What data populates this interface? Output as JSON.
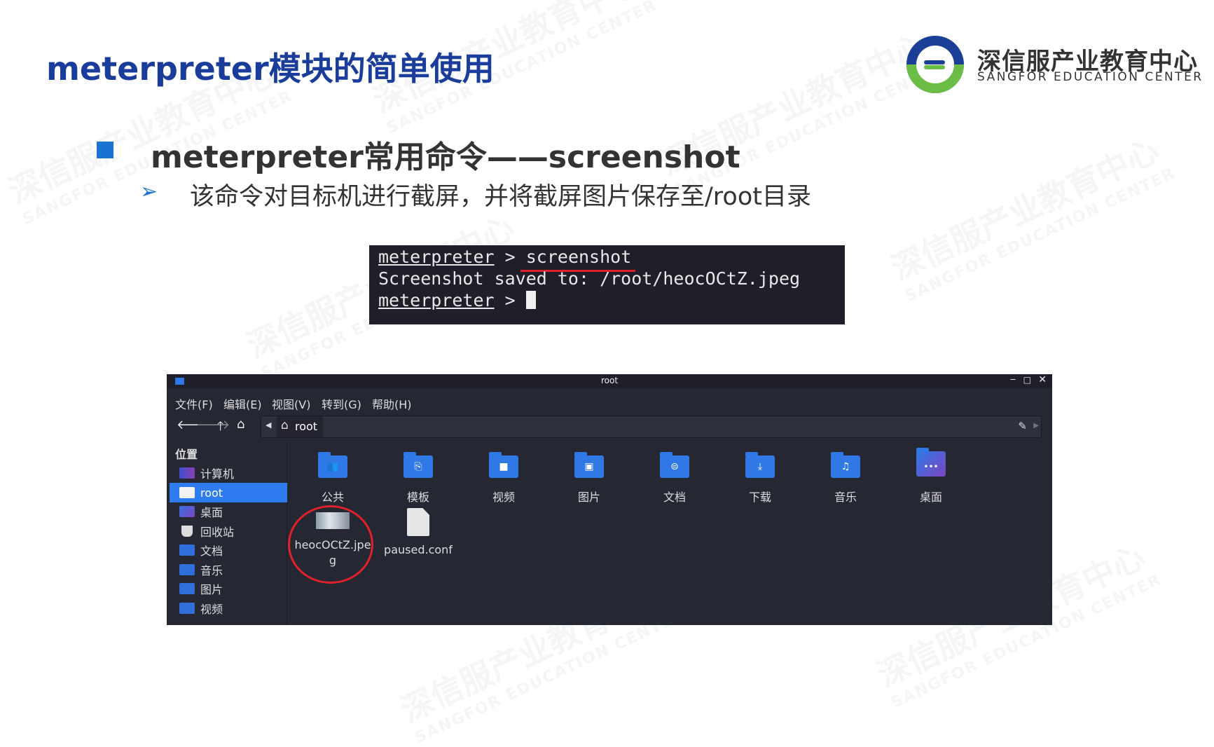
{
  "slide": {
    "title": "meterpreter模块的简单使用",
    "heading": "meterpreter常用命令——screenshot",
    "description": "该命令对目标机进行截屏，并将截屏图片保存至/root目录",
    "accent": "#1a73d0"
  },
  "logo": {
    "name_cn": "深信服产业教育中心",
    "name_en": "SANGFOR EDUCATION CENTER"
  },
  "terminal": {
    "lines": [
      {
        "prompt": "meterpreter",
        "sep": " > ",
        "cmd": "screenshot"
      },
      {
        "text": "Screenshot saved to: /root/heocOCtZ.jpeg"
      },
      {
        "prompt": "meterpreter",
        "sep": " > "
      }
    ]
  },
  "file_manager": {
    "title": "root",
    "menu": [
      "文件(F)",
      "编辑(E)",
      "视图(V)",
      "转到(G)",
      "帮助(H)"
    ],
    "path": "root",
    "sidebar": {
      "heading": "位置",
      "items": [
        "计算机",
        "root",
        "桌面",
        "回收站",
        "文档",
        "音乐",
        "图片",
        "视频"
      ],
      "selected": "root"
    },
    "items": [
      {
        "name": "公共",
        "icon": "people"
      },
      {
        "name": "模板",
        "icon": "template"
      },
      {
        "name": "视频",
        "icon": "video"
      },
      {
        "name": "图片",
        "icon": "image"
      },
      {
        "name": "文档",
        "icon": "document"
      },
      {
        "name": "下载",
        "icon": "download"
      },
      {
        "name": "音乐",
        "icon": "music"
      },
      {
        "name": "桌面",
        "icon": "desktop"
      },
      {
        "name": "heocOCtZ.jpeg",
        "name_line1": "heocOCtZ.jpe",
        "name_line2": "g",
        "icon": "image-thumbnail"
      },
      {
        "name": "paused.conf",
        "icon": "text-file"
      }
    ]
  }
}
